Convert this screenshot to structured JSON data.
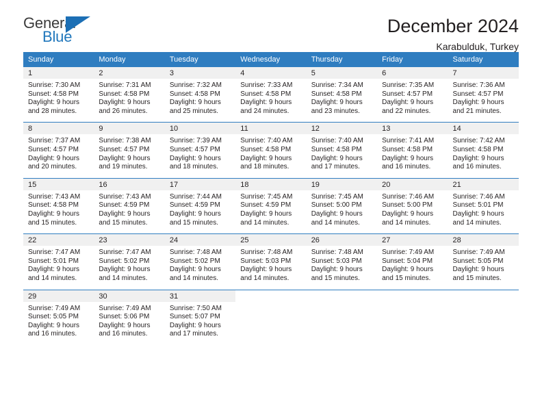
{
  "brand": {
    "name_part1": "General",
    "name_part2": "Blue",
    "accent_color": "#2077bc"
  },
  "header": {
    "title": "December 2024",
    "subtitle": "Karabulduk, Turkey"
  },
  "calendar": {
    "header_color": "#2f7dc0",
    "weekday_headers": [
      "Sunday",
      "Monday",
      "Tuesday",
      "Wednesday",
      "Thursday",
      "Friday",
      "Saturday"
    ],
    "weeks": [
      [
        {
          "day": "1",
          "sunrise": "Sunrise: 7:30 AM",
          "sunset": "Sunset: 4:58 PM",
          "daylight1": "Daylight: 9 hours",
          "daylight2": "and 28 minutes."
        },
        {
          "day": "2",
          "sunrise": "Sunrise: 7:31 AM",
          "sunset": "Sunset: 4:58 PM",
          "daylight1": "Daylight: 9 hours",
          "daylight2": "and 26 minutes."
        },
        {
          "day": "3",
          "sunrise": "Sunrise: 7:32 AM",
          "sunset": "Sunset: 4:58 PM",
          "daylight1": "Daylight: 9 hours",
          "daylight2": "and 25 minutes."
        },
        {
          "day": "4",
          "sunrise": "Sunrise: 7:33 AM",
          "sunset": "Sunset: 4:58 PM",
          "daylight1": "Daylight: 9 hours",
          "daylight2": "and 24 minutes."
        },
        {
          "day": "5",
          "sunrise": "Sunrise: 7:34 AM",
          "sunset": "Sunset: 4:58 PM",
          "daylight1": "Daylight: 9 hours",
          "daylight2": "and 23 minutes."
        },
        {
          "day": "6",
          "sunrise": "Sunrise: 7:35 AM",
          "sunset": "Sunset: 4:57 PM",
          "daylight1": "Daylight: 9 hours",
          "daylight2": "and 22 minutes."
        },
        {
          "day": "7",
          "sunrise": "Sunrise: 7:36 AM",
          "sunset": "Sunset: 4:57 PM",
          "daylight1": "Daylight: 9 hours",
          "daylight2": "and 21 minutes."
        }
      ],
      [
        {
          "day": "8",
          "sunrise": "Sunrise: 7:37 AM",
          "sunset": "Sunset: 4:57 PM",
          "daylight1": "Daylight: 9 hours",
          "daylight2": "and 20 minutes."
        },
        {
          "day": "9",
          "sunrise": "Sunrise: 7:38 AM",
          "sunset": "Sunset: 4:57 PM",
          "daylight1": "Daylight: 9 hours",
          "daylight2": "and 19 minutes."
        },
        {
          "day": "10",
          "sunrise": "Sunrise: 7:39 AM",
          "sunset": "Sunset: 4:57 PM",
          "daylight1": "Daylight: 9 hours",
          "daylight2": "and 18 minutes."
        },
        {
          "day": "11",
          "sunrise": "Sunrise: 7:40 AM",
          "sunset": "Sunset: 4:58 PM",
          "daylight1": "Daylight: 9 hours",
          "daylight2": "and 18 minutes."
        },
        {
          "day": "12",
          "sunrise": "Sunrise: 7:40 AM",
          "sunset": "Sunset: 4:58 PM",
          "daylight1": "Daylight: 9 hours",
          "daylight2": "and 17 minutes."
        },
        {
          "day": "13",
          "sunrise": "Sunrise: 7:41 AM",
          "sunset": "Sunset: 4:58 PM",
          "daylight1": "Daylight: 9 hours",
          "daylight2": "and 16 minutes."
        },
        {
          "day": "14",
          "sunrise": "Sunrise: 7:42 AM",
          "sunset": "Sunset: 4:58 PM",
          "daylight1": "Daylight: 9 hours",
          "daylight2": "and 16 minutes."
        }
      ],
      [
        {
          "day": "15",
          "sunrise": "Sunrise: 7:43 AM",
          "sunset": "Sunset: 4:58 PM",
          "daylight1": "Daylight: 9 hours",
          "daylight2": "and 15 minutes."
        },
        {
          "day": "16",
          "sunrise": "Sunrise: 7:43 AM",
          "sunset": "Sunset: 4:59 PM",
          "daylight1": "Daylight: 9 hours",
          "daylight2": "and 15 minutes."
        },
        {
          "day": "17",
          "sunrise": "Sunrise: 7:44 AM",
          "sunset": "Sunset: 4:59 PM",
          "daylight1": "Daylight: 9 hours",
          "daylight2": "and 15 minutes."
        },
        {
          "day": "18",
          "sunrise": "Sunrise: 7:45 AM",
          "sunset": "Sunset: 4:59 PM",
          "daylight1": "Daylight: 9 hours",
          "daylight2": "and 14 minutes."
        },
        {
          "day": "19",
          "sunrise": "Sunrise: 7:45 AM",
          "sunset": "Sunset: 5:00 PM",
          "daylight1": "Daylight: 9 hours",
          "daylight2": "and 14 minutes."
        },
        {
          "day": "20",
          "sunrise": "Sunrise: 7:46 AM",
          "sunset": "Sunset: 5:00 PM",
          "daylight1": "Daylight: 9 hours",
          "daylight2": "and 14 minutes."
        },
        {
          "day": "21",
          "sunrise": "Sunrise: 7:46 AM",
          "sunset": "Sunset: 5:01 PM",
          "daylight1": "Daylight: 9 hours",
          "daylight2": "and 14 minutes."
        }
      ],
      [
        {
          "day": "22",
          "sunrise": "Sunrise: 7:47 AM",
          "sunset": "Sunset: 5:01 PM",
          "daylight1": "Daylight: 9 hours",
          "daylight2": "and 14 minutes."
        },
        {
          "day": "23",
          "sunrise": "Sunrise: 7:47 AM",
          "sunset": "Sunset: 5:02 PM",
          "daylight1": "Daylight: 9 hours",
          "daylight2": "and 14 minutes."
        },
        {
          "day": "24",
          "sunrise": "Sunrise: 7:48 AM",
          "sunset": "Sunset: 5:02 PM",
          "daylight1": "Daylight: 9 hours",
          "daylight2": "and 14 minutes."
        },
        {
          "day": "25",
          "sunrise": "Sunrise: 7:48 AM",
          "sunset": "Sunset: 5:03 PM",
          "daylight1": "Daylight: 9 hours",
          "daylight2": "and 14 minutes."
        },
        {
          "day": "26",
          "sunrise": "Sunrise: 7:48 AM",
          "sunset": "Sunset: 5:03 PM",
          "daylight1": "Daylight: 9 hours",
          "daylight2": "and 15 minutes."
        },
        {
          "day": "27",
          "sunrise": "Sunrise: 7:49 AM",
          "sunset": "Sunset: 5:04 PM",
          "daylight1": "Daylight: 9 hours",
          "daylight2": "and 15 minutes."
        },
        {
          "day": "28",
          "sunrise": "Sunrise: 7:49 AM",
          "sunset": "Sunset: 5:05 PM",
          "daylight1": "Daylight: 9 hours",
          "daylight2": "and 15 minutes."
        }
      ],
      [
        {
          "day": "29",
          "sunrise": "Sunrise: 7:49 AM",
          "sunset": "Sunset: 5:05 PM",
          "daylight1": "Daylight: 9 hours",
          "daylight2": "and 16 minutes."
        },
        {
          "day": "30",
          "sunrise": "Sunrise: 7:49 AM",
          "sunset": "Sunset: 5:06 PM",
          "daylight1": "Daylight: 9 hours",
          "daylight2": "and 16 minutes."
        },
        {
          "day": "31",
          "sunrise": "Sunrise: 7:50 AM",
          "sunset": "Sunset: 5:07 PM",
          "daylight1": "Daylight: 9 hours",
          "daylight2": "and 17 minutes."
        },
        {
          "day": "",
          "sunrise": "",
          "sunset": "",
          "daylight1": "",
          "daylight2": ""
        },
        {
          "day": "",
          "sunrise": "",
          "sunset": "",
          "daylight1": "",
          "daylight2": ""
        },
        {
          "day": "",
          "sunrise": "",
          "sunset": "",
          "daylight1": "",
          "daylight2": ""
        },
        {
          "day": "",
          "sunrise": "",
          "sunset": "",
          "daylight1": "",
          "daylight2": ""
        }
      ]
    ]
  }
}
